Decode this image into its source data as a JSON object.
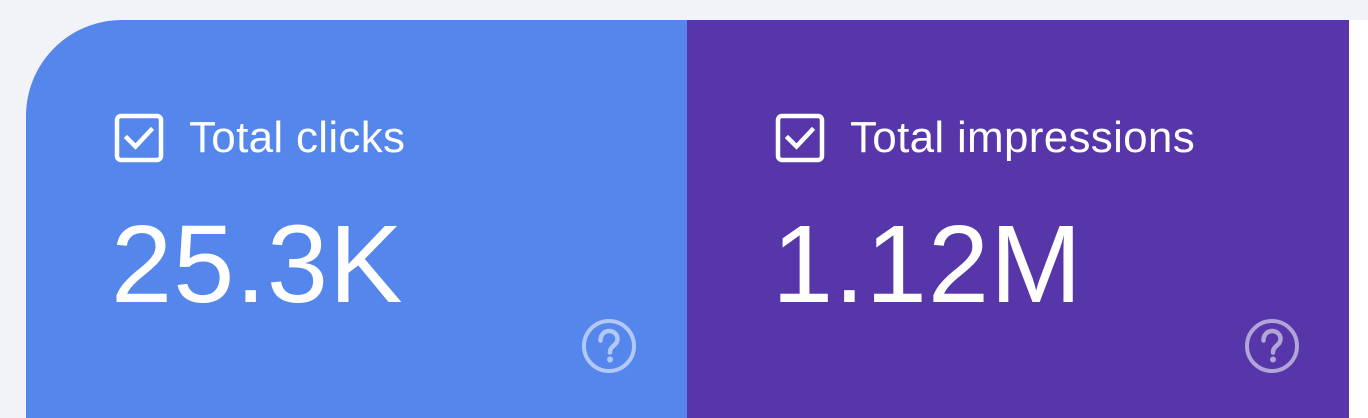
{
  "colors": {
    "page_background": "#f1f3f6",
    "clicks_card": "#5586eb",
    "impressions_card": "#5636a8",
    "text": "#ffffff"
  },
  "metrics": [
    {
      "id": "clicks",
      "label": "Total clicks",
      "value": "25.3K",
      "checked": true,
      "checkbox_icon": "checkbox-checked-icon",
      "help_icon": "help-circle-icon"
    },
    {
      "id": "impressions",
      "label": "Total impressions",
      "value": "1.12M",
      "checked": true,
      "checkbox_icon": "checkbox-checked-icon",
      "help_icon": "help-circle-icon"
    }
  ]
}
